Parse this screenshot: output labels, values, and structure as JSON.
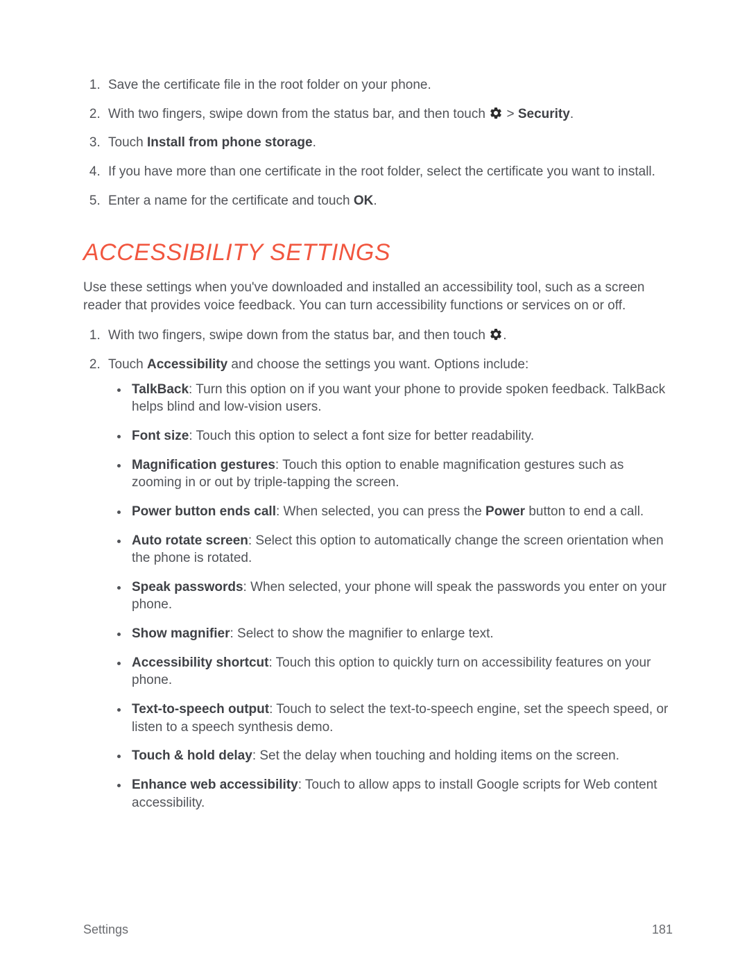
{
  "cert_steps": {
    "s1": "Save the certificate file in the root folder on your phone.",
    "s2a": "With two fingers, swipe down from the status bar, and then touch ",
    "s2b": " > ",
    "s2_bold": "Security",
    "s2c": ".",
    "s3a": "Touch ",
    "s3_bold": "Install from phone storage",
    "s3b": ".",
    "s4": "If you have more than one certificate in the root folder, select the certificate you want to install.",
    "s5a": "Enter a name for the certificate and touch ",
    "s5_bold": "OK",
    "s5b": "."
  },
  "section_title": "Accessibility Settings",
  "intro": "Use these settings when you've downloaded and installed an accessibility tool, such as a screen reader that provides voice feedback. You can turn accessibility functions or services on or off.",
  "acc_steps": {
    "s1a": "With two fingers, swipe down from the status bar, and then touch ",
    "s1b": ".",
    "s2a": "Touch ",
    "s2_bold": "Accessibility",
    "s2b": " and choose the settings you want. Options include:"
  },
  "options": {
    "o1_bold": "TalkBack",
    "o1_text": ": Turn this option on if you want your phone to provide spoken feedback. TalkBack helps blind and low-vision users.",
    "o2_bold": "Font size",
    "o2_text": ": Touch this option to select a font size for better readability.",
    "o3_bold": "Magnification gestures",
    "o3_text": ": Touch this option to enable magnification gestures such as zooming in or out by triple-tapping the screen.",
    "o4_bold": "Power button ends call",
    "o4_text_a": ": When selected, you can press the ",
    "o4_bold2": "Power",
    "o4_text_b": " button to end a call.",
    "o5_bold": "Auto rotate screen",
    "o5_text": ": Select this option to automatically change the screen orientation when the phone is rotated.",
    "o6_bold": "Speak passwords",
    "o6_text": ": When selected, your phone will speak the passwords you enter on your phone.",
    "o7_bold": "Show magnifier",
    "o7_text": ": Select to show the magnifier to enlarge text.",
    "o8_bold": "Accessibility shortcut",
    "o8_text": ": Touch this option to quickly turn on accessibility features on your phone.",
    "o9_bold": "Text-to-speech output",
    "o9_text": ": Touch to select the text-to-speech engine, set the speech speed, or listen to a speech synthesis demo.",
    "o10_bold": "Touch & hold delay",
    "o10_text": ": Set the delay when touching and holding items on the screen.",
    "o11_bold": "Enhance web accessibility",
    "o11_text": ": Touch to allow apps to install Google scripts for Web content accessibility."
  },
  "footer": {
    "section": "Settings",
    "page": "181"
  }
}
